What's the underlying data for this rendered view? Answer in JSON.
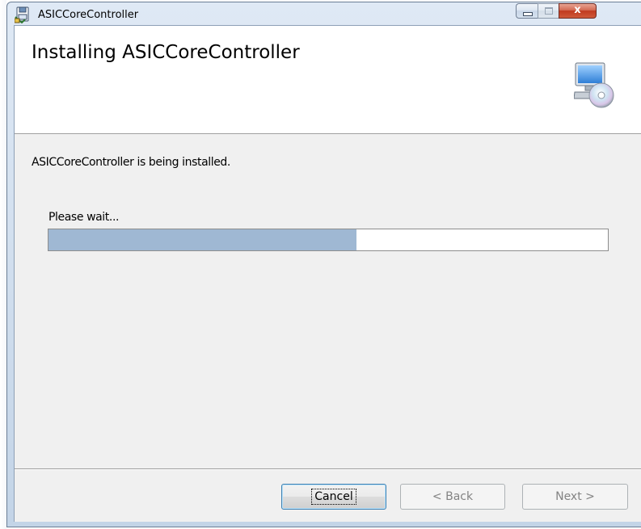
{
  "window": {
    "title": "ASICCoreController",
    "close_glyph": "x",
    "icon": "installer-icon"
  },
  "banner": {
    "title": "Installing ASICCoreController",
    "icon": "computer-disc-icon"
  },
  "body": {
    "status": "ASICCoreController is being installed.",
    "wait_label": "Please wait...",
    "progress_percent": 55
  },
  "buttons": {
    "cancel": "Cancel",
    "back": "< Back",
    "next": "Next >"
  }
}
